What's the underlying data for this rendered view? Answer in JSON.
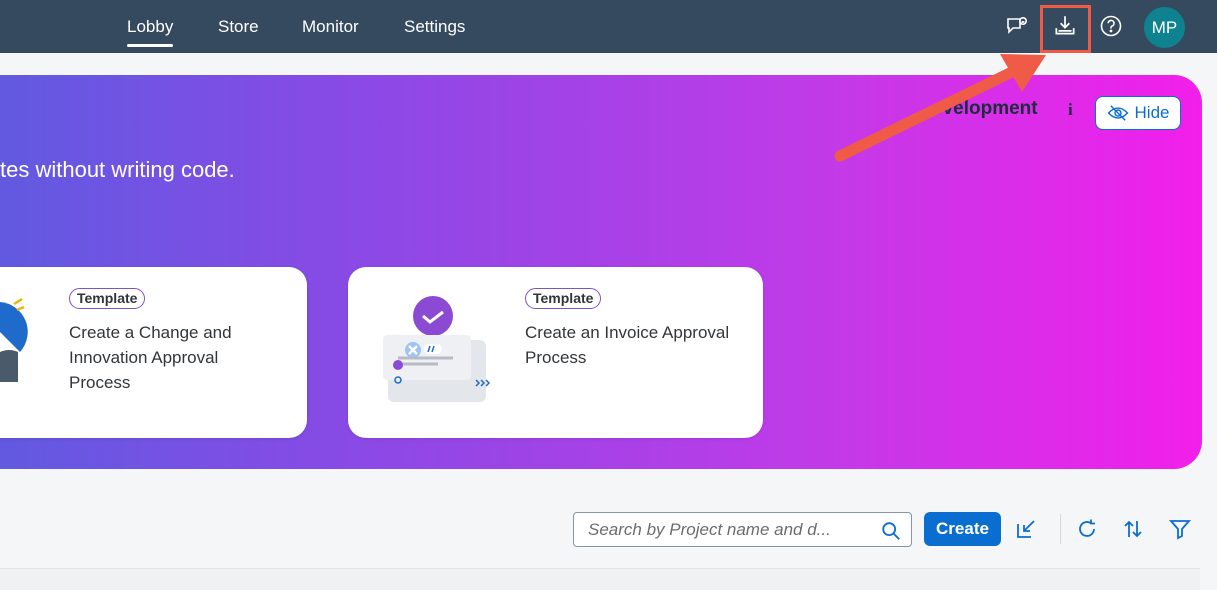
{
  "nav": {
    "tabs": [
      {
        "label": "Lobby",
        "active": true
      },
      {
        "label": "Store",
        "active": false
      },
      {
        "label": "Monitor",
        "active": false
      },
      {
        "label": "Settings",
        "active": false
      }
    ]
  },
  "shell": {
    "icons": [
      "feedback-icon",
      "download-icon",
      "help-icon"
    ],
    "avatar_initials": "MP"
  },
  "hero": {
    "subtitle": "tes without writing code.",
    "title": "evelopment",
    "info_glyph": "i",
    "hide_label": "Hide"
  },
  "cards": [
    {
      "badge": "Template",
      "title_lines": [
        "Create a Change and",
        "Innovation Approval",
        "Process"
      ]
    },
    {
      "badge": "Template",
      "title_lines": [
        "Create an Invoice Approval",
        "Process"
      ]
    }
  ],
  "toolbar": {
    "search_placeholder": "Search by Project name and d...",
    "create_label": "Create"
  },
  "colors": {
    "shellbar": "#354a5f",
    "accent": "#0a6ed1",
    "highlight": "#ef5b47",
    "avatar": "#0f828f"
  }
}
